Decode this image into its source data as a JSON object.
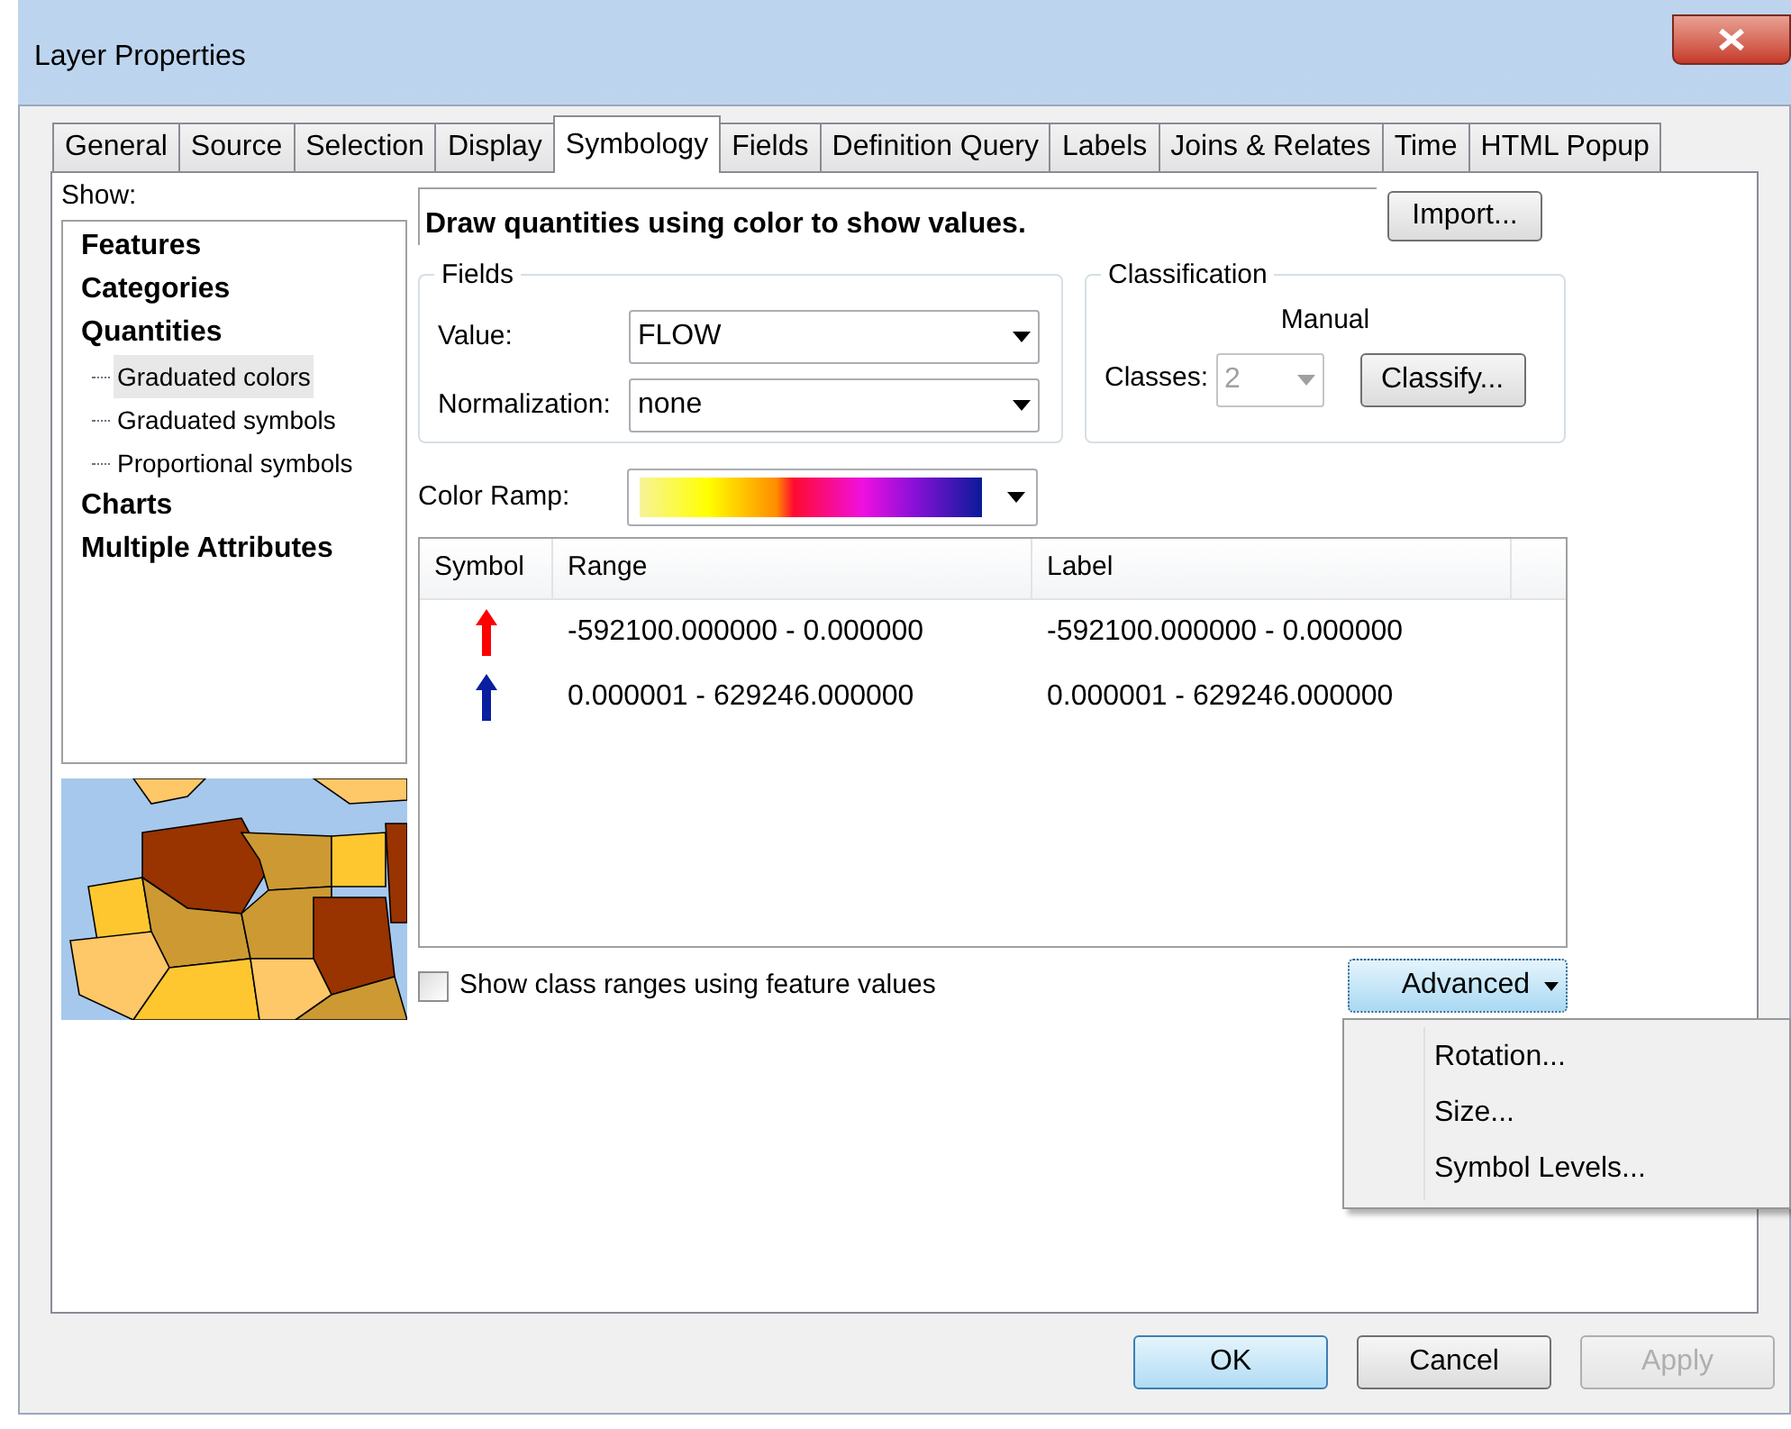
{
  "window": {
    "title": "Layer Properties"
  },
  "tabs": [
    {
      "label": "General",
      "selected": false
    },
    {
      "label": "Source",
      "selected": false
    },
    {
      "label": "Selection",
      "selected": false
    },
    {
      "label": "Display",
      "selected": false
    },
    {
      "label": "Symbology",
      "selected": true
    },
    {
      "label": "Fields",
      "selected": false
    },
    {
      "label": "Definition Query",
      "selected": false
    },
    {
      "label": "Labels",
      "selected": false
    },
    {
      "label": "Joins & Relates",
      "selected": false
    },
    {
      "label": "Time",
      "selected": false
    },
    {
      "label": "HTML Popup",
      "selected": false
    }
  ],
  "show": {
    "label": "Show:",
    "tree": [
      {
        "label": "Features",
        "selected": false
      },
      {
        "label": "Categories",
        "selected": false
      },
      {
        "label": "Quantities",
        "selected": false,
        "children": [
          {
            "label": "Graduated colors",
            "selected": true
          },
          {
            "label": "Graduated symbols",
            "selected": false
          },
          {
            "label": "Proportional symbols",
            "selected": false
          }
        ]
      },
      {
        "label": "Charts",
        "selected": false
      },
      {
        "label": "Multiple Attributes",
        "selected": false
      }
    ]
  },
  "description": "Draw quantities using color to show values.",
  "import_button": "Import...",
  "fields": {
    "title": "Fields",
    "value_label": "Value:",
    "value": "FLOW",
    "normalization_label": "Normalization:",
    "normalization": "none"
  },
  "classification": {
    "title": "Classification",
    "method": "Manual",
    "classes_label": "Classes:",
    "classes": "2",
    "classes_disabled": true,
    "classify_button": "Classify..."
  },
  "color_ramp": {
    "label": "Color Ramp:"
  },
  "table": {
    "columns": [
      "Symbol",
      "Range",
      "Label"
    ],
    "rows": [
      {
        "color": "#ff0000",
        "range": "-592100.000000 - 0.000000",
        "label": "-592100.000000 - 0.000000"
      },
      {
        "color": "#0a1ea0",
        "range": "0.000001 - 629246.000000",
        "label": "0.000001 - 629246.000000"
      }
    ]
  },
  "show_class_ranges": {
    "label": "Show class ranges using feature values",
    "checked": false
  },
  "advanced": {
    "label": "Advanced",
    "menu": [
      {
        "label": "Rotation..."
      },
      {
        "label": "Size..."
      },
      {
        "label": "Symbol Levels..."
      }
    ]
  },
  "buttons": [
    {
      "label": "OK",
      "kind": "default",
      "disabled": false
    },
    {
      "label": "Cancel",
      "kind": "normal",
      "disabled": false
    },
    {
      "label": "Apply",
      "kind": "normal",
      "disabled": true
    }
  ]
}
